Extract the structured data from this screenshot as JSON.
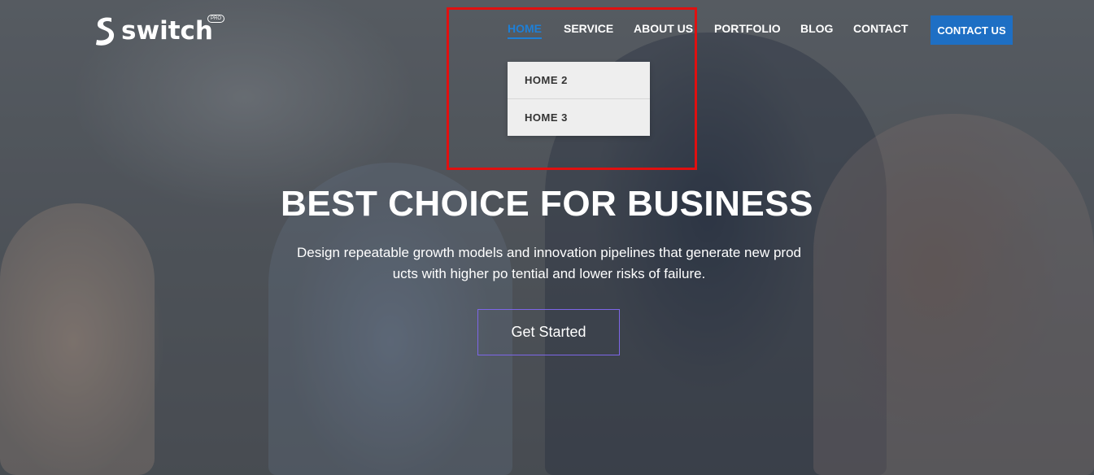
{
  "logo": {
    "text": "switch",
    "badge": "PRO"
  },
  "nav": {
    "items": [
      {
        "label": "HOME"
      },
      {
        "label": "SERVICE"
      },
      {
        "label": "ABOUT US"
      },
      {
        "label": "PORTFOLIO"
      },
      {
        "label": "BLOG"
      },
      {
        "label": "CONTACT"
      }
    ],
    "cta": "CONTACT US",
    "dropdown": [
      "HOME 2",
      "HOME 3"
    ]
  },
  "hero": {
    "title": "BEST CHOICE FOR BUSINESS",
    "subtitle_line1": "Design repeatable growth models and innovation pipelines that generate new prod",
    "subtitle_line2": "ucts with higher po tential and lower risks of failure.",
    "cta": "Get Started"
  },
  "colors": {
    "accent": "#1e7fd6",
    "cta_bg": "#1e6fc4",
    "highlight": "#e01010",
    "button_border": "#7d66e8"
  }
}
